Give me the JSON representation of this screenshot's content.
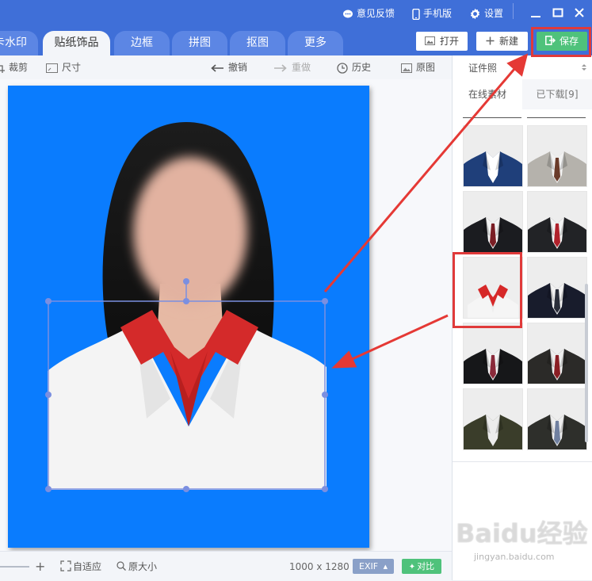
{
  "titlebar": {
    "feedback": "意见反馈",
    "mobile": "手机版",
    "settings": "设置"
  },
  "tabs": [
    {
      "label": "卡水印",
      "active": false
    },
    {
      "label": "贴纸饰品",
      "active": true
    },
    {
      "label": "边框",
      "active": false
    },
    {
      "label": "拼图",
      "active": false
    },
    {
      "label": "抠图",
      "active": false
    },
    {
      "label": "更多",
      "active": false
    }
  ],
  "actions": {
    "open": "打开",
    "new": "新建",
    "save": "保存"
  },
  "toolbar": {
    "crop": "裁剪",
    "size": "尺寸",
    "undo": "撤销",
    "redo": "重做",
    "history": "历史",
    "original": "原图"
  },
  "statusbar": {
    "fit": "自适应",
    "actual_size": "原大小",
    "dimensions": "1000 x 1280",
    "exif": "EXIF",
    "compare": "对比"
  },
  "panel": {
    "category": "证件照",
    "tab_online": "在线素材",
    "tab_downloaded": "已下载[9]",
    "thumbnails": [
      {
        "name": "navy-suit-white-shirt",
        "suit": "#1f3f7a",
        "shirt": "#ffffff",
        "tie": ""
      },
      {
        "name": "grey-suit-brown-tie",
        "suit": "#b5b2ac",
        "shirt": "#f2f2f2",
        "tie": "#6a3b2a"
      },
      {
        "name": "black-suit-red-tie",
        "suit": "#1b1c20",
        "shirt": "#f4f4f4",
        "tie": "#7a1e25"
      },
      {
        "name": "black-suit-red-tie-2",
        "suit": "#222326",
        "shirt": "#f4f4f4",
        "tie": "#b0222c"
      },
      {
        "name": "white-suit-red-collar",
        "suit": "#f5f5f5",
        "shirt": "#d62828",
        "tie": ""
      },
      {
        "name": "navy-suit-dark-tie",
        "suit": "#181c2c",
        "shirt": "#f2f2f2",
        "tie": "#2a2e3a"
      },
      {
        "name": "black-suit-striped-tie",
        "suit": "#161719",
        "shirt": "#f4f4f4",
        "tie": "#8a2a3a"
      },
      {
        "name": "dark-suit-red-tie",
        "suit": "#2b2a28",
        "shirt": "#eeeeee",
        "tie": "#8a1e24"
      },
      {
        "name": "olive-suit",
        "suit": "#3a3d2a",
        "shirt": "#ececec",
        "tie": ""
      },
      {
        "name": "dark-suit-blue-tie",
        "suit": "#2e2f2b",
        "shirt": "#eeeeee",
        "tie": "#7080a0"
      }
    ]
  },
  "colors": {
    "titlebar": "#3f6fd8",
    "photo_background": "#0a7cfe",
    "save_green": "#4fc27b",
    "highlight_red": "#e03a3a"
  },
  "watermark": {
    "brand": "Baidu经验",
    "url": "jingyan.baidu.com"
  }
}
